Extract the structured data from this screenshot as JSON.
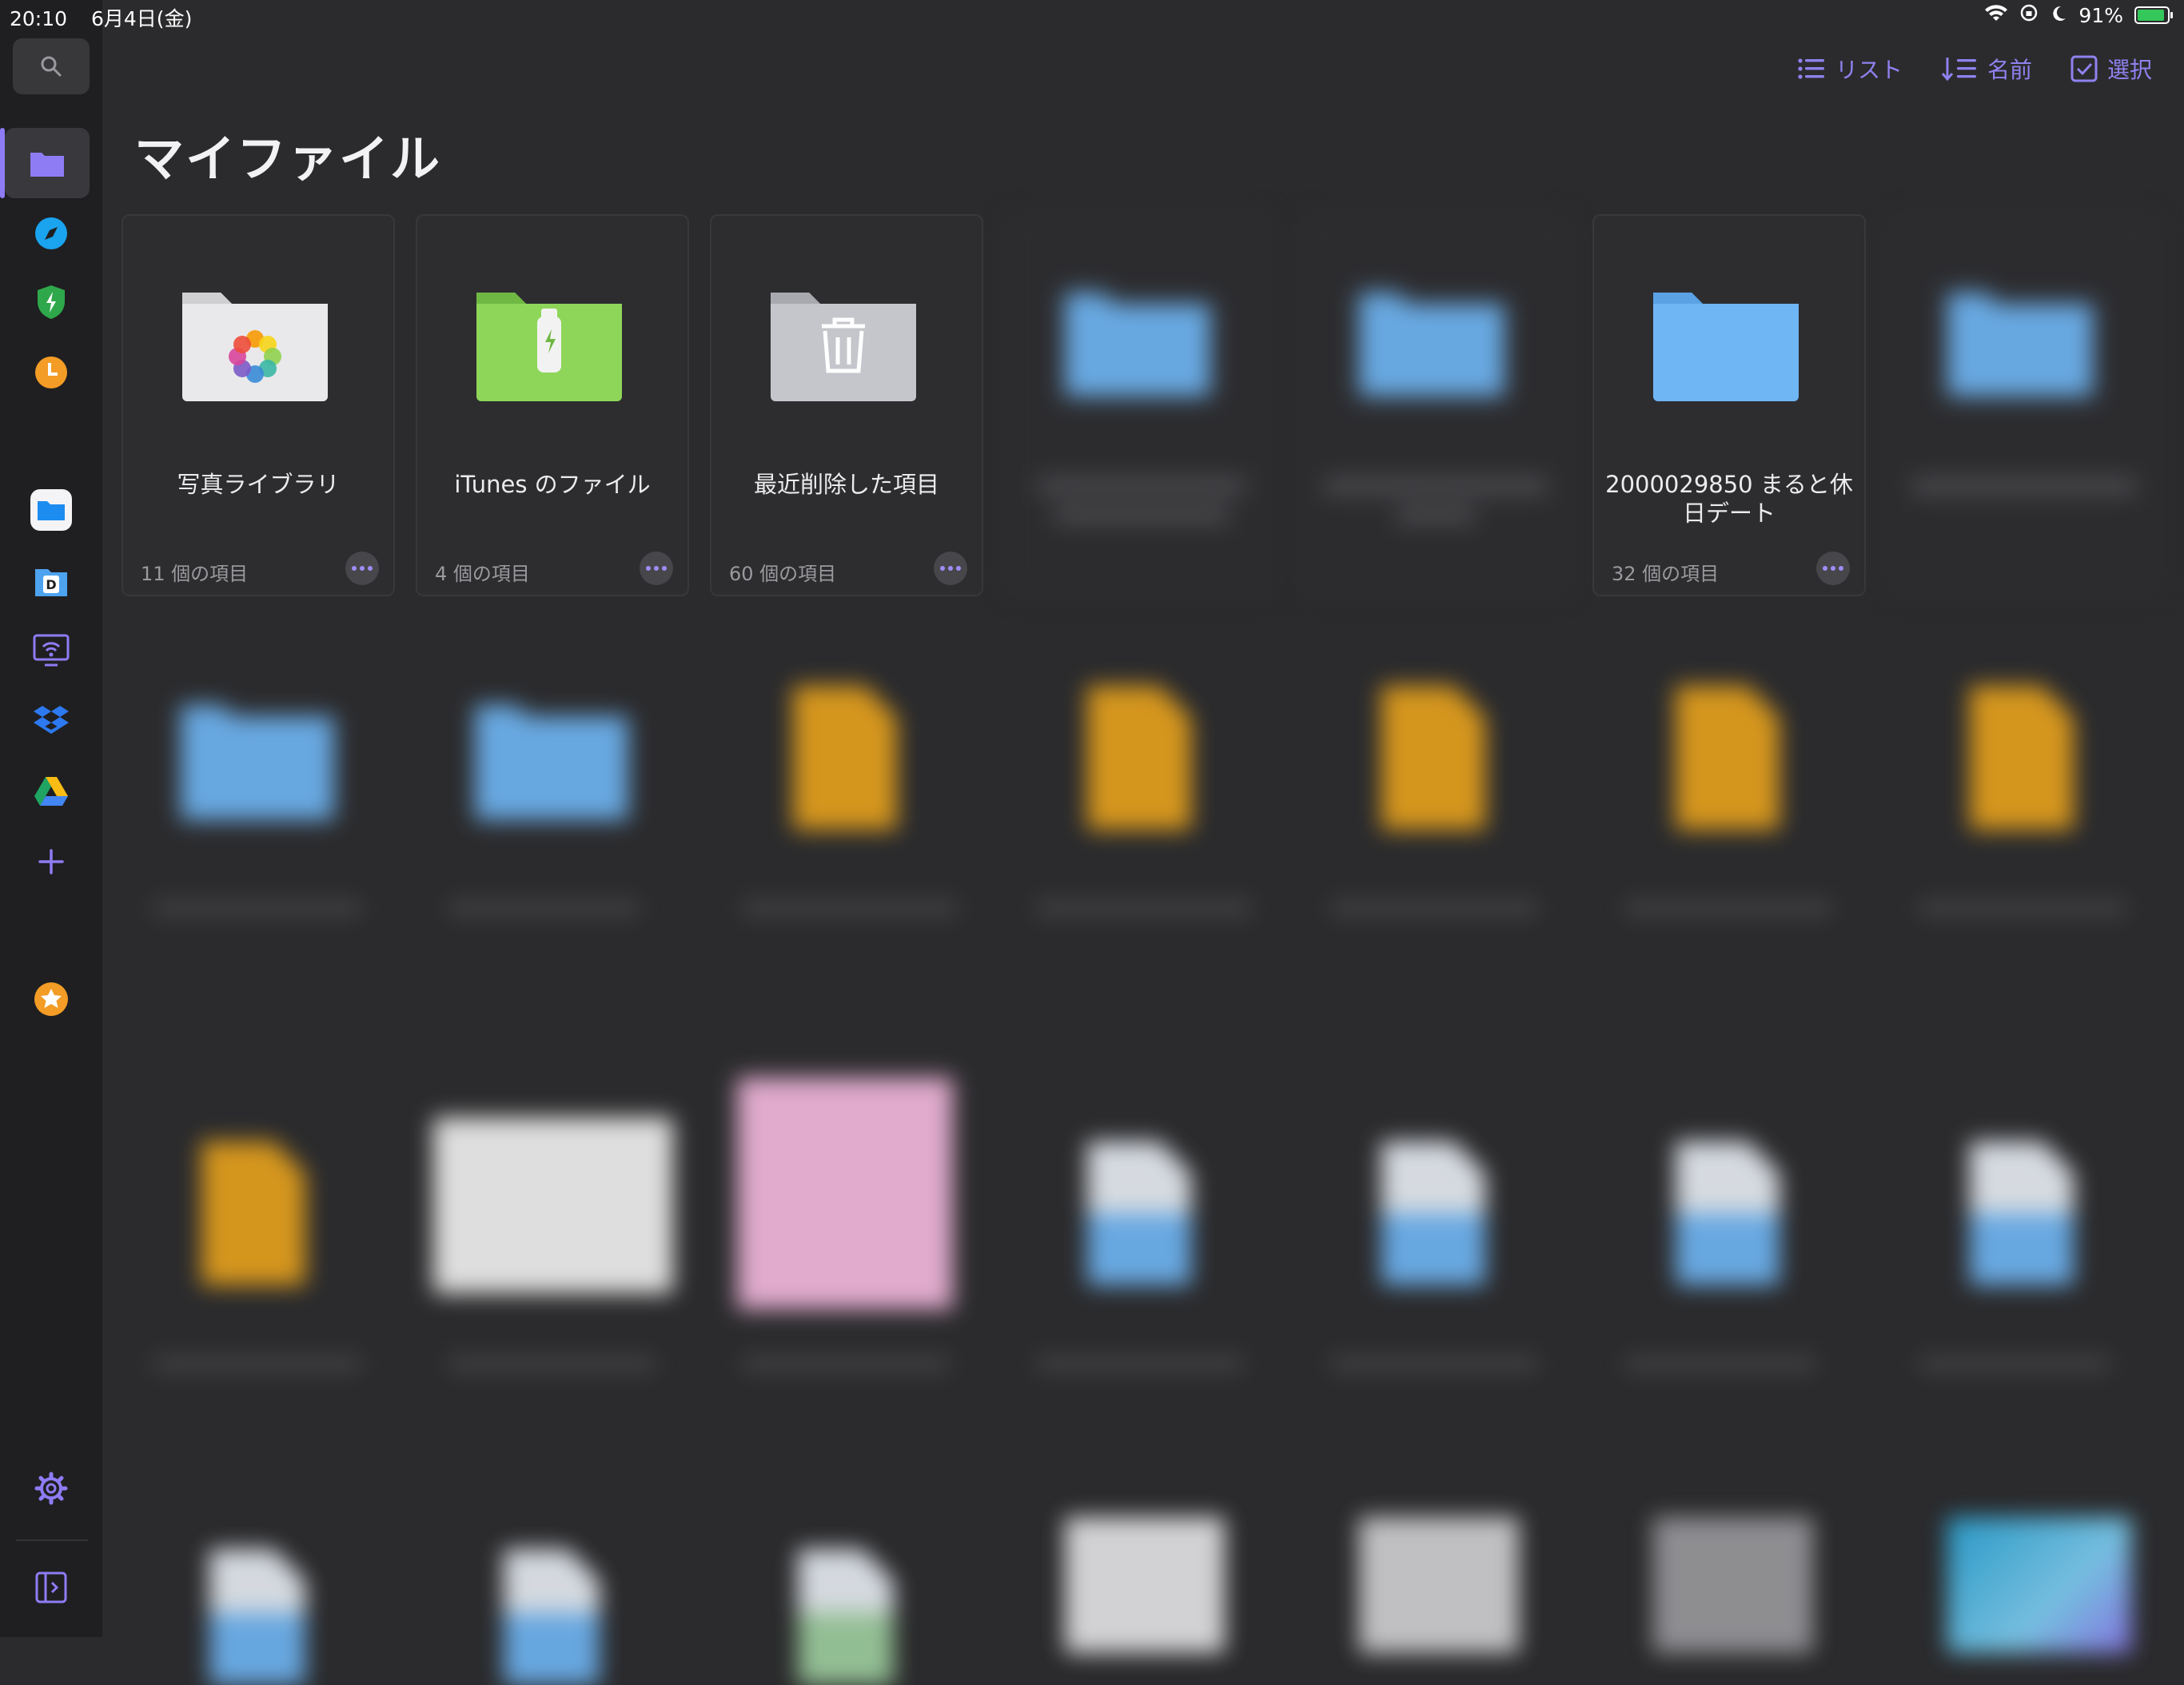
{
  "status": {
    "time": "20:10",
    "date": "6月4日(金)",
    "battery_percent": "91%",
    "battery_level": 0.91
  },
  "toolbar": {
    "list_label": "リスト",
    "sort_label": "名前",
    "select_label": "選択"
  },
  "page": {
    "title": "マイファイル"
  },
  "sidebar": {
    "icons": [
      "search-icon",
      "folder-icon",
      "compass-icon",
      "shield-icon",
      "clock-icon",
      "files-app-icon",
      "documents-icon",
      "wifi-transfer-icon",
      "dropbox-icon",
      "google-drive-icon",
      "add-icon",
      "favorites-icon",
      "settings-icon",
      "sidebar-toggle-icon"
    ]
  },
  "cards": [
    {
      "name": "写真ライブラリ",
      "meta": "11 個の項目",
      "kind": "photos"
    },
    {
      "name": "iTunes のファイル",
      "meta": "4 個の項目",
      "kind": "itunes"
    },
    {
      "name": "最近削除した項目",
      "meta": "60 個の項目",
      "kind": "trash"
    },
    {
      "name": "",
      "meta": "",
      "kind": "folder-blurred"
    },
    {
      "name": "",
      "meta": "",
      "kind": "folder-blurred"
    },
    {
      "name": "2000029850 まると休日デート",
      "meta": "32 個の項目",
      "kind": "folder"
    },
    {
      "name": "",
      "meta": "",
      "kind": "folder-blurred"
    }
  ],
  "colors": {
    "accent": "#8f82f0",
    "background": "#2b2b2d",
    "sidebar": "#1f1f21",
    "folder_blue": "#6fb6f5",
    "itunes_green": "#8ed65a"
  }
}
